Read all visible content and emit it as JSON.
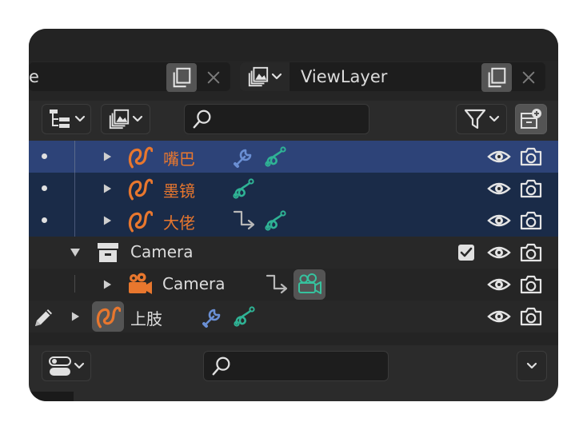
{
  "header": {
    "scene_field_text": "e",
    "view_layer_text": "ViewLayer"
  },
  "outliner": {
    "rows": [
      {
        "label": "嘴巴",
        "color": "#e8772e"
      },
      {
        "label": "墨镜",
        "color": "#e8772e"
      },
      {
        "label": "大佬",
        "color": "#e8772e"
      },
      {
        "label": "Camera",
        "color": "#dcdcdc"
      },
      {
        "label": "Camera",
        "color": "#dcdcdc"
      },
      {
        "label": "上肢",
        "color": "#dcdcdc"
      }
    ]
  },
  "colors": {
    "selected_active": "#2d4378",
    "selected": "#1a2b48",
    "object_orange": "#e8772e",
    "modifier_blue": "#6a8fd4",
    "constraint_green": "#2fb395",
    "camera_data_green": "#36c29e"
  },
  "icons": [
    "scene-browse-icon",
    "copy-icon",
    "close-icon",
    "image-icon",
    "display-mode-icon",
    "search-icon",
    "filter-icon",
    "new-collection-icon",
    "curve-object-icon",
    "wrench-modifier-icon",
    "curve-data-icon",
    "constraint-arrow-icon",
    "collection-icon",
    "camera-object-icon",
    "camera-data-icon",
    "eye-icon",
    "render-camera-icon",
    "checkbox-checked-icon",
    "pencil-edit-icon",
    "chevron-down-icon"
  ]
}
